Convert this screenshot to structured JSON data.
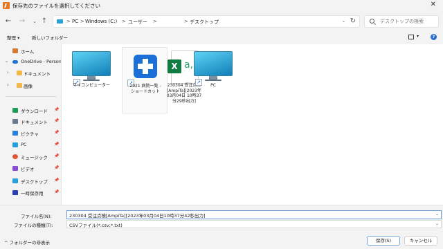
{
  "window": {
    "title": "保存先のファイルを選択してください",
    "close_glyph": "✕"
  },
  "nav": {
    "back_glyph": "←",
    "forward_glyph": "→",
    "dropdown_glyph": "⌄",
    "up_glyph": "↑",
    "breadcrumbs": [
      "PC",
      "Windows (C:)",
      "ユーザー",
      "",
      "デスクトップ"
    ],
    "separator": ">",
    "address_dropdown_glyph": "⌄",
    "refresh_glyph": "↻",
    "search_placeholder": "デスクトップの検索"
  },
  "toolbar": {
    "organize_label": "整理 ▾",
    "new_folder_label": "新しいフォルダー",
    "view_dropdown_glyph": "▾",
    "help_glyph": "?"
  },
  "sidebar": {
    "items": [
      {
        "label": "ホーム",
        "icon": "home-icon",
        "color": "#d07a3a"
      },
      {
        "label": "OneDrive - Persona",
        "icon": "cloud-icon",
        "color": "#1a73d8"
      },
      {
        "label": "ドキュメント",
        "icon": "folder-icon",
        "color": "#f2b84b"
      },
      {
        "label": "画像",
        "icon": "folder-icon",
        "color": "#f2b84b"
      },
      {
        "label": "ダウンロード",
        "icon": "download-icon",
        "color": "#1e9a5a"
      },
      {
        "label": "ドキュメント",
        "icon": "documents-icon",
        "color": "#6b7b8c"
      },
      {
        "label": "ピクチャ",
        "icon": "pictures-icon",
        "color": "#2a7fd6"
      },
      {
        "label": "PC",
        "icon": "pc-icon",
        "color": "#2a9fd6"
      },
      {
        "label": "ミュージック",
        "icon": "music-icon",
        "color": "#e0573c"
      },
      {
        "label": "ビデオ",
        "icon": "videos-icon",
        "color": "#8a4fd0"
      },
      {
        "label": "デスクトップ",
        "icon": "desktop-icon",
        "color": "#2a9fd6"
      },
      {
        "label": "一時保存用",
        "icon": "folder-icon",
        "color": "#2a3fb0"
      }
    ],
    "chevron_glyph": "›",
    "pin_glyph": "📌"
  },
  "files": [
    {
      "label": "マイコンピューター",
      "type": "monitor-shortcut"
    },
    {
      "label": "2021 病院一覧 -\nショートカット",
      "type": "medical-shortcut"
    },
    {
      "label": "230304 受注点検\n[AmpiTa][2023年\n03月04日 10時37\n分29秒出力]",
      "type": "excel"
    },
    {
      "label": "PC",
      "type": "monitor-shortcut"
    }
  ],
  "file_icons": {
    "shortcut_glyph": "↗",
    "excel_letter": "X",
    "excel_glyph": "a,"
  },
  "form": {
    "filename_label": "ファイル名(N):",
    "filename_value": "230304 受注点検[AmpiTa][2023年03月04日10時37分42秒出力]",
    "filetype_label": "ファイルの種類(T):",
    "filetype_value": "CSVファイル(*.csv;*.txt)",
    "dropdown_glyph": "⌄"
  },
  "footer": {
    "hide_folders_label": "^ フォルダーの非表示",
    "save_label": "保存(S)",
    "cancel_label": "キャンセル"
  }
}
